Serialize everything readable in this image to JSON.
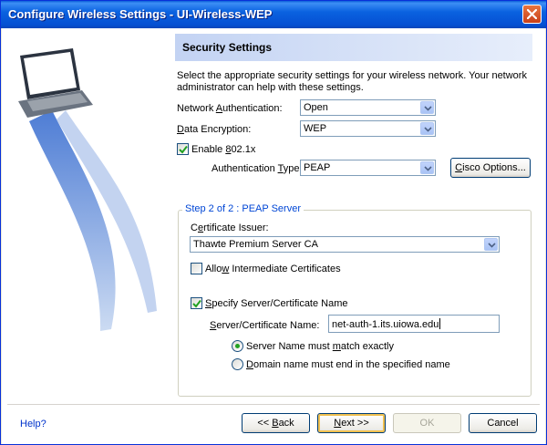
{
  "window": {
    "title": "Configure Wireless Settings - UI-Wireless-WEP"
  },
  "header": {
    "title": "Security Settings"
  },
  "intro": "Select the appropriate security settings for your wireless network. Your network administrator can help with these settings.",
  "network_auth": {
    "label_pre": "Network ",
    "label_key": "A",
    "label_post": "uthentication:",
    "value": "Open"
  },
  "data_encryption": {
    "label_pre": "",
    "label_key": "D",
    "label_post": "ata Encryption:",
    "value": "WEP"
  },
  "enable_8021x": {
    "label_pre": "Enable ",
    "label_key": "8",
    "label_post": "02.1x",
    "checked": true
  },
  "auth_type": {
    "label_pre": "Authentication ",
    "label_key": "T",
    "label_post": "ype:",
    "value": "PEAP"
  },
  "cisco_options": {
    "label_pre": "",
    "label_key": "C",
    "label_post": "isco Options..."
  },
  "group": {
    "legend": "Step 2 of 2 : PEAP Server"
  },
  "cert_issuer": {
    "label_pre": "C",
    "label_key": "e",
    "label_post": "rtificate Issuer:",
    "value": "Thawte Premium Server CA"
  },
  "allow_intermediate": {
    "label_pre": "Allo",
    "label_key": "w",
    "label_post": " Intermediate Certificates",
    "checked": false
  },
  "specify_server": {
    "label_pre": "",
    "label_key": "S",
    "label_post": "pecify Server/Certificate Name",
    "checked": true
  },
  "server_name": {
    "label_pre": "",
    "label_key": "S",
    "label_post": "erver/Certificate Name:",
    "value": "net-auth-1.its.uiowa.edu"
  },
  "radio_exact": {
    "label_pre": "Server Name must ",
    "label_key": "m",
    "label_post": "atch exactly",
    "selected": true
  },
  "radio_domain": {
    "label_pre": "",
    "label_key": "D",
    "label_post": "omain name must end in the specified name",
    "selected": false
  },
  "footer": {
    "help": "Help?",
    "back": {
      "label_pre": "<< ",
      "label_key": "B",
      "label_post": "ack"
    },
    "next": {
      "label_pre": "",
      "label_key": "N",
      "label_post": "ext >>"
    },
    "ok": "OK",
    "cancel": "Cancel"
  },
  "colors": {
    "titlebar": "#0a62e0",
    "header_band": "#c3d3f3",
    "link": "#0033cc",
    "legend": "#0046d5"
  }
}
